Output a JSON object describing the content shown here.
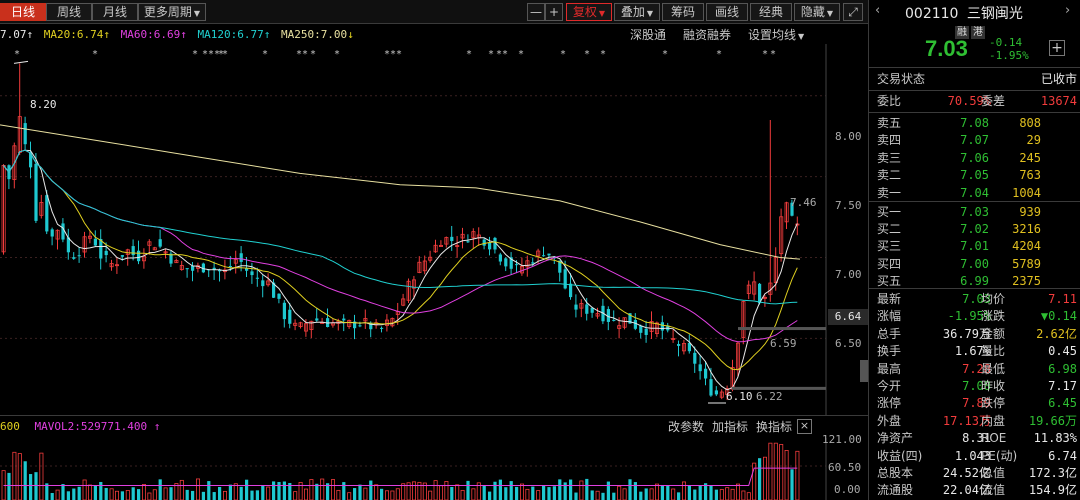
{
  "toolbar": {
    "tabs": [
      "日线",
      "周线",
      "月线",
      "更多周期"
    ],
    "active_tab": 0,
    "minus_label": "—",
    "plus_label": "+",
    "fuquan": "复权",
    "overlay": "叠加",
    "chips": "筹码",
    "draw": "画线",
    "classic": "经典",
    "hide": "隐藏"
  },
  "ma": {
    "ma5": "7.07",
    "ma20": "MA20:6.74",
    "ma60": "MA60:6.69",
    "ma120": "MA120:6.77",
    "ma250": "MA250:7.00",
    "links": [
      "深股通",
      "融资融券",
      "设置均线"
    ]
  },
  "price_axis": {
    "labels": [
      "8.00",
      "7.50",
      "7.00",
      "6.50"
    ],
    "current": "6.64"
  },
  "annotations": {
    "high": "8.20",
    "recent_high": "7.46",
    "low": "6.10",
    "mid1": "6.59",
    "mid2": "6.22",
    "markers": "*  *  *  ***  *  *  **  *  *  *  *  ** *"
  },
  "volume": {
    "header_vol": "600",
    "mavol": "MAVOL2:529771.400",
    "links": [
      "改参数",
      "加指标",
      "换指标"
    ],
    "close_icon": "×",
    "axis_labels": [
      "121.00",
      "60.50",
      "0.00"
    ],
    "unit": "万"
  },
  "quote": {
    "code": "002110",
    "name": "三钢闽光",
    "badge1": "融",
    "badge2": "港",
    "price": "7.03",
    "change": "-0.14",
    "change_pct": "-1.95%",
    "status_label": "交易状态",
    "status_value": "已收市",
    "weibi_label": "委比",
    "weibi": "70.59%",
    "weicha_label": "委差",
    "weicha": "13674",
    "sells": [
      {
        "label": "卖五",
        "price": "7.08",
        "vol": "808"
      },
      {
        "label": "卖四",
        "price": "7.07",
        "vol": "29"
      },
      {
        "label": "卖三",
        "price": "7.06",
        "vol": "245"
      },
      {
        "label": "卖二",
        "price": "7.05",
        "vol": "763"
      },
      {
        "label": "卖一",
        "price": "7.04",
        "vol": "1004"
      }
    ],
    "buys": [
      {
        "label": "买一",
        "price": "7.03",
        "vol": "939"
      },
      {
        "label": "买二",
        "price": "7.02",
        "vol": "3216"
      },
      {
        "label": "买三",
        "price": "7.01",
        "vol": "4204"
      },
      {
        "label": "买四",
        "price": "7.00",
        "vol": "5789"
      },
      {
        "label": "买五",
        "price": "6.99",
        "vol": "2375"
      }
    ],
    "stats": [
      {
        "l1": "最新",
        "v1": "7.03",
        "c1": "green",
        "l2": "均价",
        "v2": "7.11",
        "c2": "red"
      },
      {
        "l1": "涨幅",
        "v1": "-1.95%",
        "c1": "green",
        "l2": "涨跌",
        "v2": "▼0.14",
        "c2": "green"
      },
      {
        "l1": "总手",
        "v1": "36.79万",
        "c1": "white",
        "l2": "金额",
        "v2": "2.62亿",
        "c2": "yellow"
      },
      {
        "l1": "换手",
        "v1": "1.67%",
        "c1": "white",
        "l2": "量比",
        "v2": "0.45",
        "c2": "white"
      },
      {
        "l1": "最高",
        "v1": "7.28",
        "c1": "red",
        "l2": "最低",
        "v2": "6.98",
        "c2": "green"
      },
      {
        "l1": "今开",
        "v1": "7.08",
        "c1": "green",
        "l2": "昨收",
        "v2": "7.17",
        "c2": "white"
      },
      {
        "l1": "涨停",
        "v1": "7.89",
        "c1": "red",
        "l2": "跌停",
        "v2": "6.45",
        "c2": "green"
      },
      {
        "l1": "外盘",
        "v1": "17.13万",
        "c1": "red",
        "l2": "内盘",
        "v2": "19.66万",
        "c2": "green"
      },
      {
        "l1": "净资产",
        "v1": "8.31",
        "c1": "white",
        "l2": "ROE",
        "v2": "11.83%",
        "c2": "white"
      },
      {
        "l1": "收益(四)",
        "v1": "1.043",
        "c1": "white",
        "l2": "PE(动)",
        "v2": "6.74",
        "c2": "white"
      },
      {
        "l1": "总股本",
        "v1": "24.52亿",
        "c1": "white",
        "l2": "总值",
        "v2": "172.3亿",
        "c2": "white"
      },
      {
        "l1": "流通股",
        "v1": "22.04亿",
        "c1": "white",
        "l2": "流值",
        "v2": "154.9亿",
        "c2": "white"
      }
    ]
  },
  "colors": {
    "up": "#f23c3c",
    "down": "#1ec8d0",
    "ma5": "#e8e8e8",
    "ma20": "#e0d020",
    "ma60": "#e040e0",
    "ma120": "#20d0d0",
    "ma250": "#e8e0a0"
  }
}
